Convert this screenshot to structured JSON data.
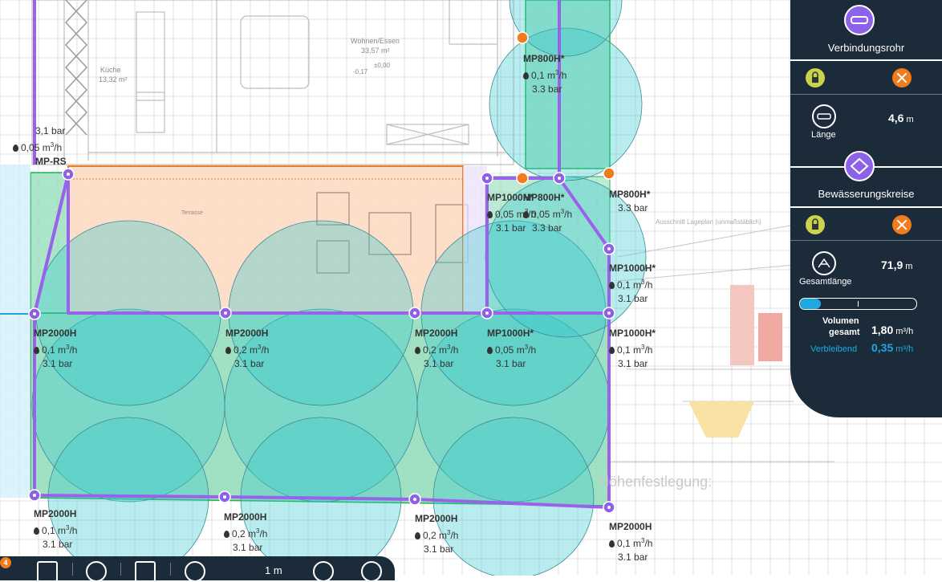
{
  "plan_texts": {
    "room_kitchen": "Küche",
    "room_kitchen_area": "13,32 m²",
    "room_living": "Wohnen/Essen",
    "room_living_area": "33,57 m²",
    "terrace": "Terrasse",
    "level_zero": "±0,00",
    "level_minus": "-0,17",
    "section_note": "Ausschnitt Lageplan (unmaßstäblich)",
    "height_title": "Höhenfestlegung:"
  },
  "sprinklers": [
    {
      "name": "MP-RS",
      "flow_value": "0,05 m",
      "flow_unit": "3",
      "flow_tail": "/h",
      "pressure": "3,1 bar"
    },
    {
      "name": "MP800H*",
      "flow_value": "0,1 m",
      "flow_unit": "3",
      "flow_tail": "/h",
      "pressure": "3.3 bar"
    },
    {
      "name": "MP1000H*",
      "flow_value": "0,05 m",
      "flow_unit": "3",
      "flow_tail": "/h",
      "pressure": "3.1 bar"
    },
    {
      "name": "MP800H*",
      "flow_value": "0,05 m",
      "flow_unit": "3",
      "flow_tail": "/h",
      "pressure": "3.3 bar"
    },
    {
      "name": "MP800H*",
      "flow_value": "",
      "flow_unit": "",
      "flow_tail": "",
      "pressure": "3.3 bar"
    },
    {
      "name": "MP1000H*",
      "flow_value": "0,1 m",
      "flow_unit": "3",
      "flow_tail": "/h",
      "pressure": "3.1 bar"
    },
    {
      "name": "MP2000H",
      "flow_value": "0,1 m",
      "flow_unit": "3",
      "flow_tail": "/h",
      "pressure": "3.1 bar"
    },
    {
      "name": "MP2000H",
      "flow_value": "0,2 m",
      "flow_unit": "3",
      "flow_tail": "/h",
      "pressure": "3.1 bar"
    },
    {
      "name": "MP2000H",
      "flow_value": "0,2 m",
      "flow_unit": "3",
      "flow_tail": "/h",
      "pressure": "3.1 bar"
    },
    {
      "name": "MP1000H*",
      "flow_value": "0,05 m",
      "flow_unit": "3",
      "flow_tail": "/h",
      "pressure": "3.1 bar"
    },
    {
      "name": "MP1000H*",
      "flow_value": "0,1 m",
      "flow_unit": "3",
      "flow_tail": "/h",
      "pressure": "3.1 bar"
    },
    {
      "name": "MP2000H",
      "flow_value": "0,1 m",
      "flow_unit": "3",
      "flow_tail": "/h",
      "pressure": "3.1 bar"
    },
    {
      "name": "MP2000H",
      "flow_value": "0,2 m",
      "flow_unit": "3",
      "flow_tail": "/h",
      "pressure": "3.1 bar"
    },
    {
      "name": "MP2000H",
      "flow_value": "0,2 m",
      "flow_unit": "3",
      "flow_tail": "/h",
      "pressure": "3.1 bar"
    },
    {
      "name": "MP2000H",
      "flow_value": "0,1 m",
      "flow_unit": "3",
      "flow_tail": "/h",
      "pressure": "3.1 bar"
    }
  ],
  "panel": {
    "section1_title": "Verbindungsrohr",
    "length_label": "Länge",
    "length_value": "4,6",
    "length_unit": "m",
    "section2_title": "Bewässerungskreise",
    "total_length_label": "Gesamtlänge",
    "total_length_value": "71,9",
    "total_length_unit": "m",
    "volume_label_1": "Volumen",
    "volume_label_2": "gesamt",
    "volume_value": "1,80",
    "volume_unit": "m³/h",
    "remaining_label": "Verbleibend",
    "remaining_value": "0,35",
    "remaining_unit": "m³/h",
    "volume_fill_fraction": 0.18,
    "accent_color": "#8c63e8",
    "remaining_color": "#1fa8e0"
  },
  "toolbar": {
    "badge": "4",
    "scale_label": "1 m",
    "icons": [
      "grid-icon",
      "contrast-icon",
      "crop-icon",
      "hand-icon",
      "zoom-in-icon",
      "zoom-out-icon"
    ]
  },
  "colors": {
    "water": "#36c8cf",
    "lawn": "#8fdcb8",
    "terrace_fill": "#fbd8bf",
    "terrace_border": "#f07c1e",
    "pipe": "#9a62ea",
    "node": "#8f60e6"
  }
}
